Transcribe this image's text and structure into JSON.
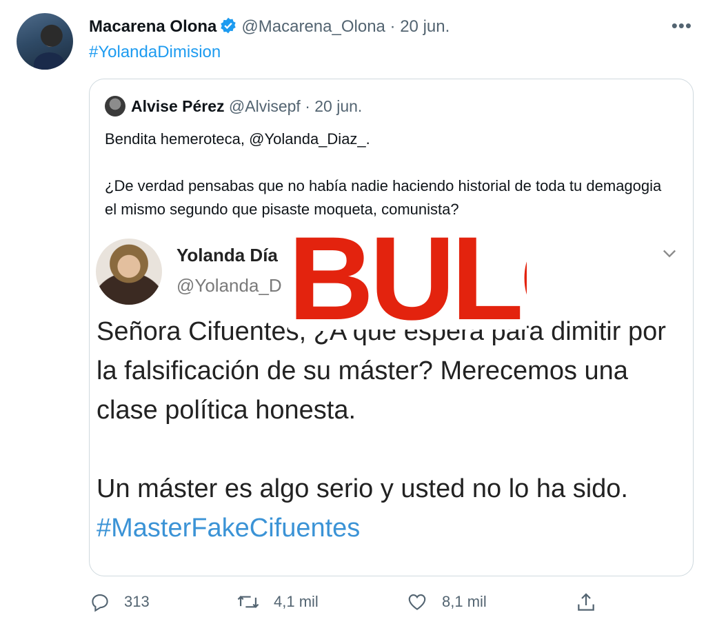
{
  "tweet": {
    "author_name": "Macarena Olona",
    "meta": "@Macarena_Olona · 20 jun.",
    "hashtag": "#YolandaDimision"
  },
  "quoted": {
    "author_name": "Alvise Pérez",
    "meta": "@Alvisepf · 20 jun.",
    "text": "Bendita hemeroteca, @Yolanda_Diaz_.\n\n¿De verdad pensabas que no había nadie haciendo historial de toda tu demagogia el mismo segundo que pisaste moqueta, comunista?",
    "screenshot": {
      "name": "Yolanda Día",
      "handle": "@Yolanda_D",
      "text": "Señora Cifuentes, ¿A qué espera para dimitir por la falsificación de su máster? Merecemos una clase política honesta.\n\nUn máster es algo serio y usted no lo ha sido. ",
      "hashtag": "#MasterFakeCifuentes"
    },
    "stamp": "BULO"
  },
  "actions": {
    "replies": "313",
    "retweets": "4,1 mil",
    "likes": "8,1 mil"
  },
  "icons": [
    "verified-icon",
    "more-icon",
    "chevron-down-icon",
    "reply-icon",
    "retweet-icon",
    "like-icon",
    "share-icon"
  ],
  "colors": {
    "link": "#1d9bf0",
    "stamp": "#e3230e",
    "muted": "#536471"
  }
}
